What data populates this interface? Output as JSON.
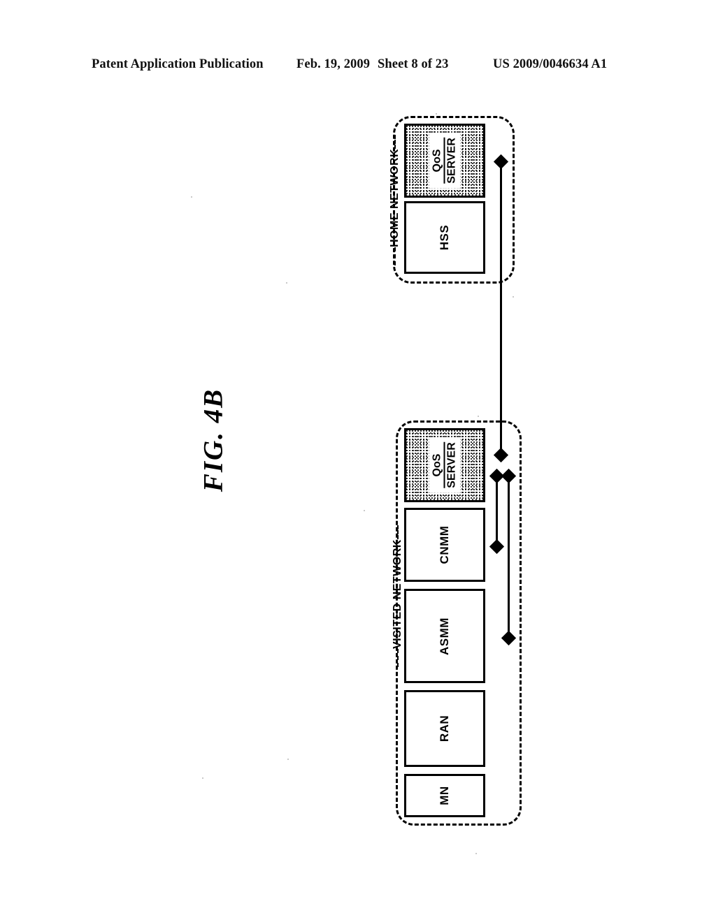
{
  "header": {
    "publication": "Patent Application Publication",
    "date": "Feb. 19, 2009",
    "sheet": "Sheet 8 of 23",
    "number": "US 2009/0046634 A1"
  },
  "figure": {
    "label": "FIG. 4B"
  },
  "diagram": {
    "home_network": {
      "label": "HOME NETWORK",
      "nodes": [
        {
          "id": "home-qos-server",
          "line1": "QoS",
          "line2": "SERVER",
          "shaded": true
        },
        {
          "id": "home-hss",
          "label": "HSS",
          "shaded": false
        }
      ]
    },
    "visited_network": {
      "label": "VISITED NETWORK",
      "nodes": [
        {
          "id": "visited-qos-server",
          "line1": "QoS",
          "line2": "SERVER",
          "shaded": true
        },
        {
          "id": "visited-cnmm",
          "label": "CNMM",
          "shaded": false
        },
        {
          "id": "visited-asmm",
          "label": "ASMM",
          "shaded": false
        },
        {
          "id": "visited-ran",
          "label": "RAN",
          "shaded": false
        },
        {
          "id": "visited-mn",
          "label": "MN",
          "shaded": false
        }
      ]
    },
    "connectors": [
      {
        "id": "qos-to-qos",
        "from": "home-qos-server",
        "to": "visited-qos-server"
      },
      {
        "id": "qos-to-cnmm",
        "from": "visited-qos-server",
        "to": "visited-cnmm"
      },
      {
        "id": "qos-to-asmm",
        "from": "visited-qos-server",
        "to": "visited-asmm"
      }
    ],
    "colors": {
      "ink": "#000000",
      "paper": "#ffffff"
    }
  }
}
